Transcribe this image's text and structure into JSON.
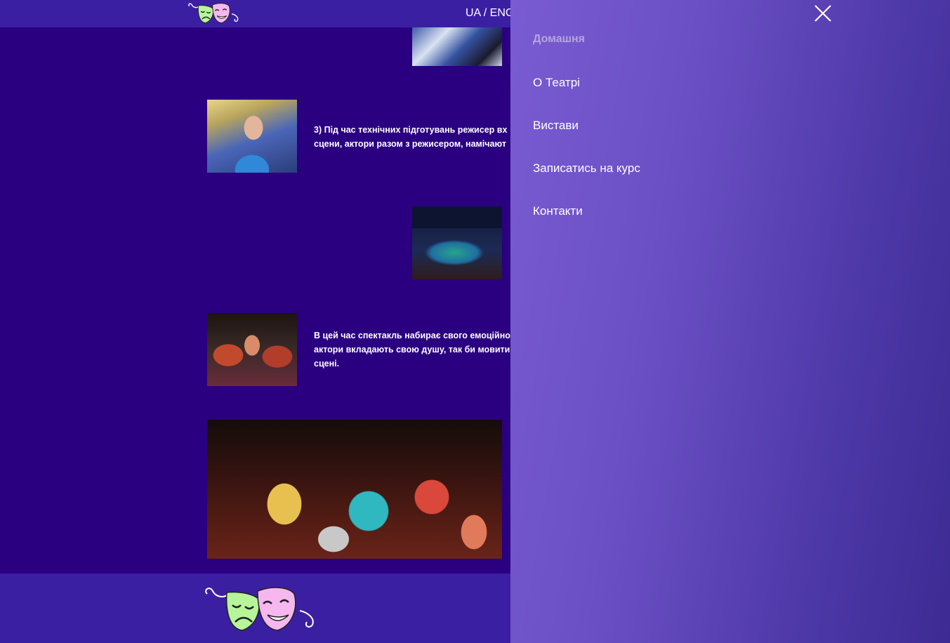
{
  "header": {
    "lang_switch": "UA / ENG"
  },
  "content": {
    "paragraph_1": [
      "3) Під час технічних підготувань режисер вх",
      "сцени, актори разом з режисером, намічают"
    ],
    "paragraph_2": [
      "В цей час спектакль набирає свого емоційно",
      "актори вкладають свою душу, так би мовити",
      "сцені."
    ]
  },
  "menu": {
    "close_icon": "close-icon",
    "items": [
      {
        "label": "Домашня",
        "active": true
      },
      {
        "label": "О Театрі",
        "active": false
      },
      {
        "label": "Вистави",
        "active": false
      },
      {
        "label": "Записатись на курс",
        "active": false
      },
      {
        "label": "Контакти",
        "active": false
      }
    ]
  },
  "icons": {
    "logo": "theatre-masks-icon"
  },
  "colors": {
    "page_bg": "#2a0081",
    "header_bg": "#3b1fa3",
    "mask_comedy": "#f6b7ef",
    "mask_tragedy": "#b7f59a"
  }
}
